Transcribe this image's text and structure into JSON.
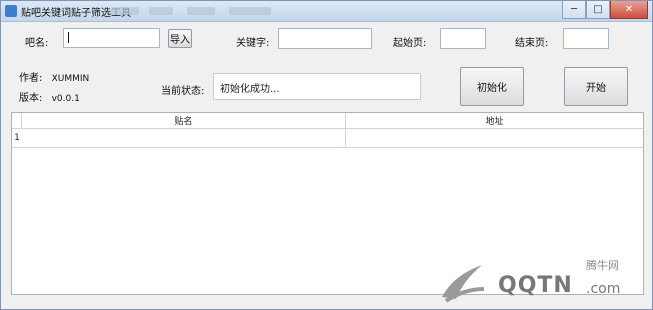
{
  "window": {
    "title": "贴吧关键词贴子筛选工具",
    "controls": {
      "minimize": "─",
      "maximize": "□",
      "close": "✕"
    }
  },
  "form": {
    "bar_label": "吧名:",
    "bar_value": "",
    "import_label": "导入",
    "keyword_label": "关键字:",
    "keyword_value": "",
    "start_label": "起始页:",
    "start_value": "",
    "end_label": "结束页:",
    "end_value": ""
  },
  "info": {
    "author_label": "作者:",
    "author_value": "XUMMIN",
    "version_label": "版本:",
    "version_value": "v0.0.1",
    "status_label": "当前状态:",
    "status_value": "初始化成功..."
  },
  "actions": {
    "init_label": "初始化",
    "start_label": "开始"
  },
  "table": {
    "columns": [
      "贴名",
      "地址"
    ],
    "rows": [
      {
        "index": "1",
        "name": "",
        "url": ""
      }
    ]
  },
  "watermark": {
    "brand": "腾牛网",
    "site": "QQTN",
    "suffix": ".com"
  }
}
